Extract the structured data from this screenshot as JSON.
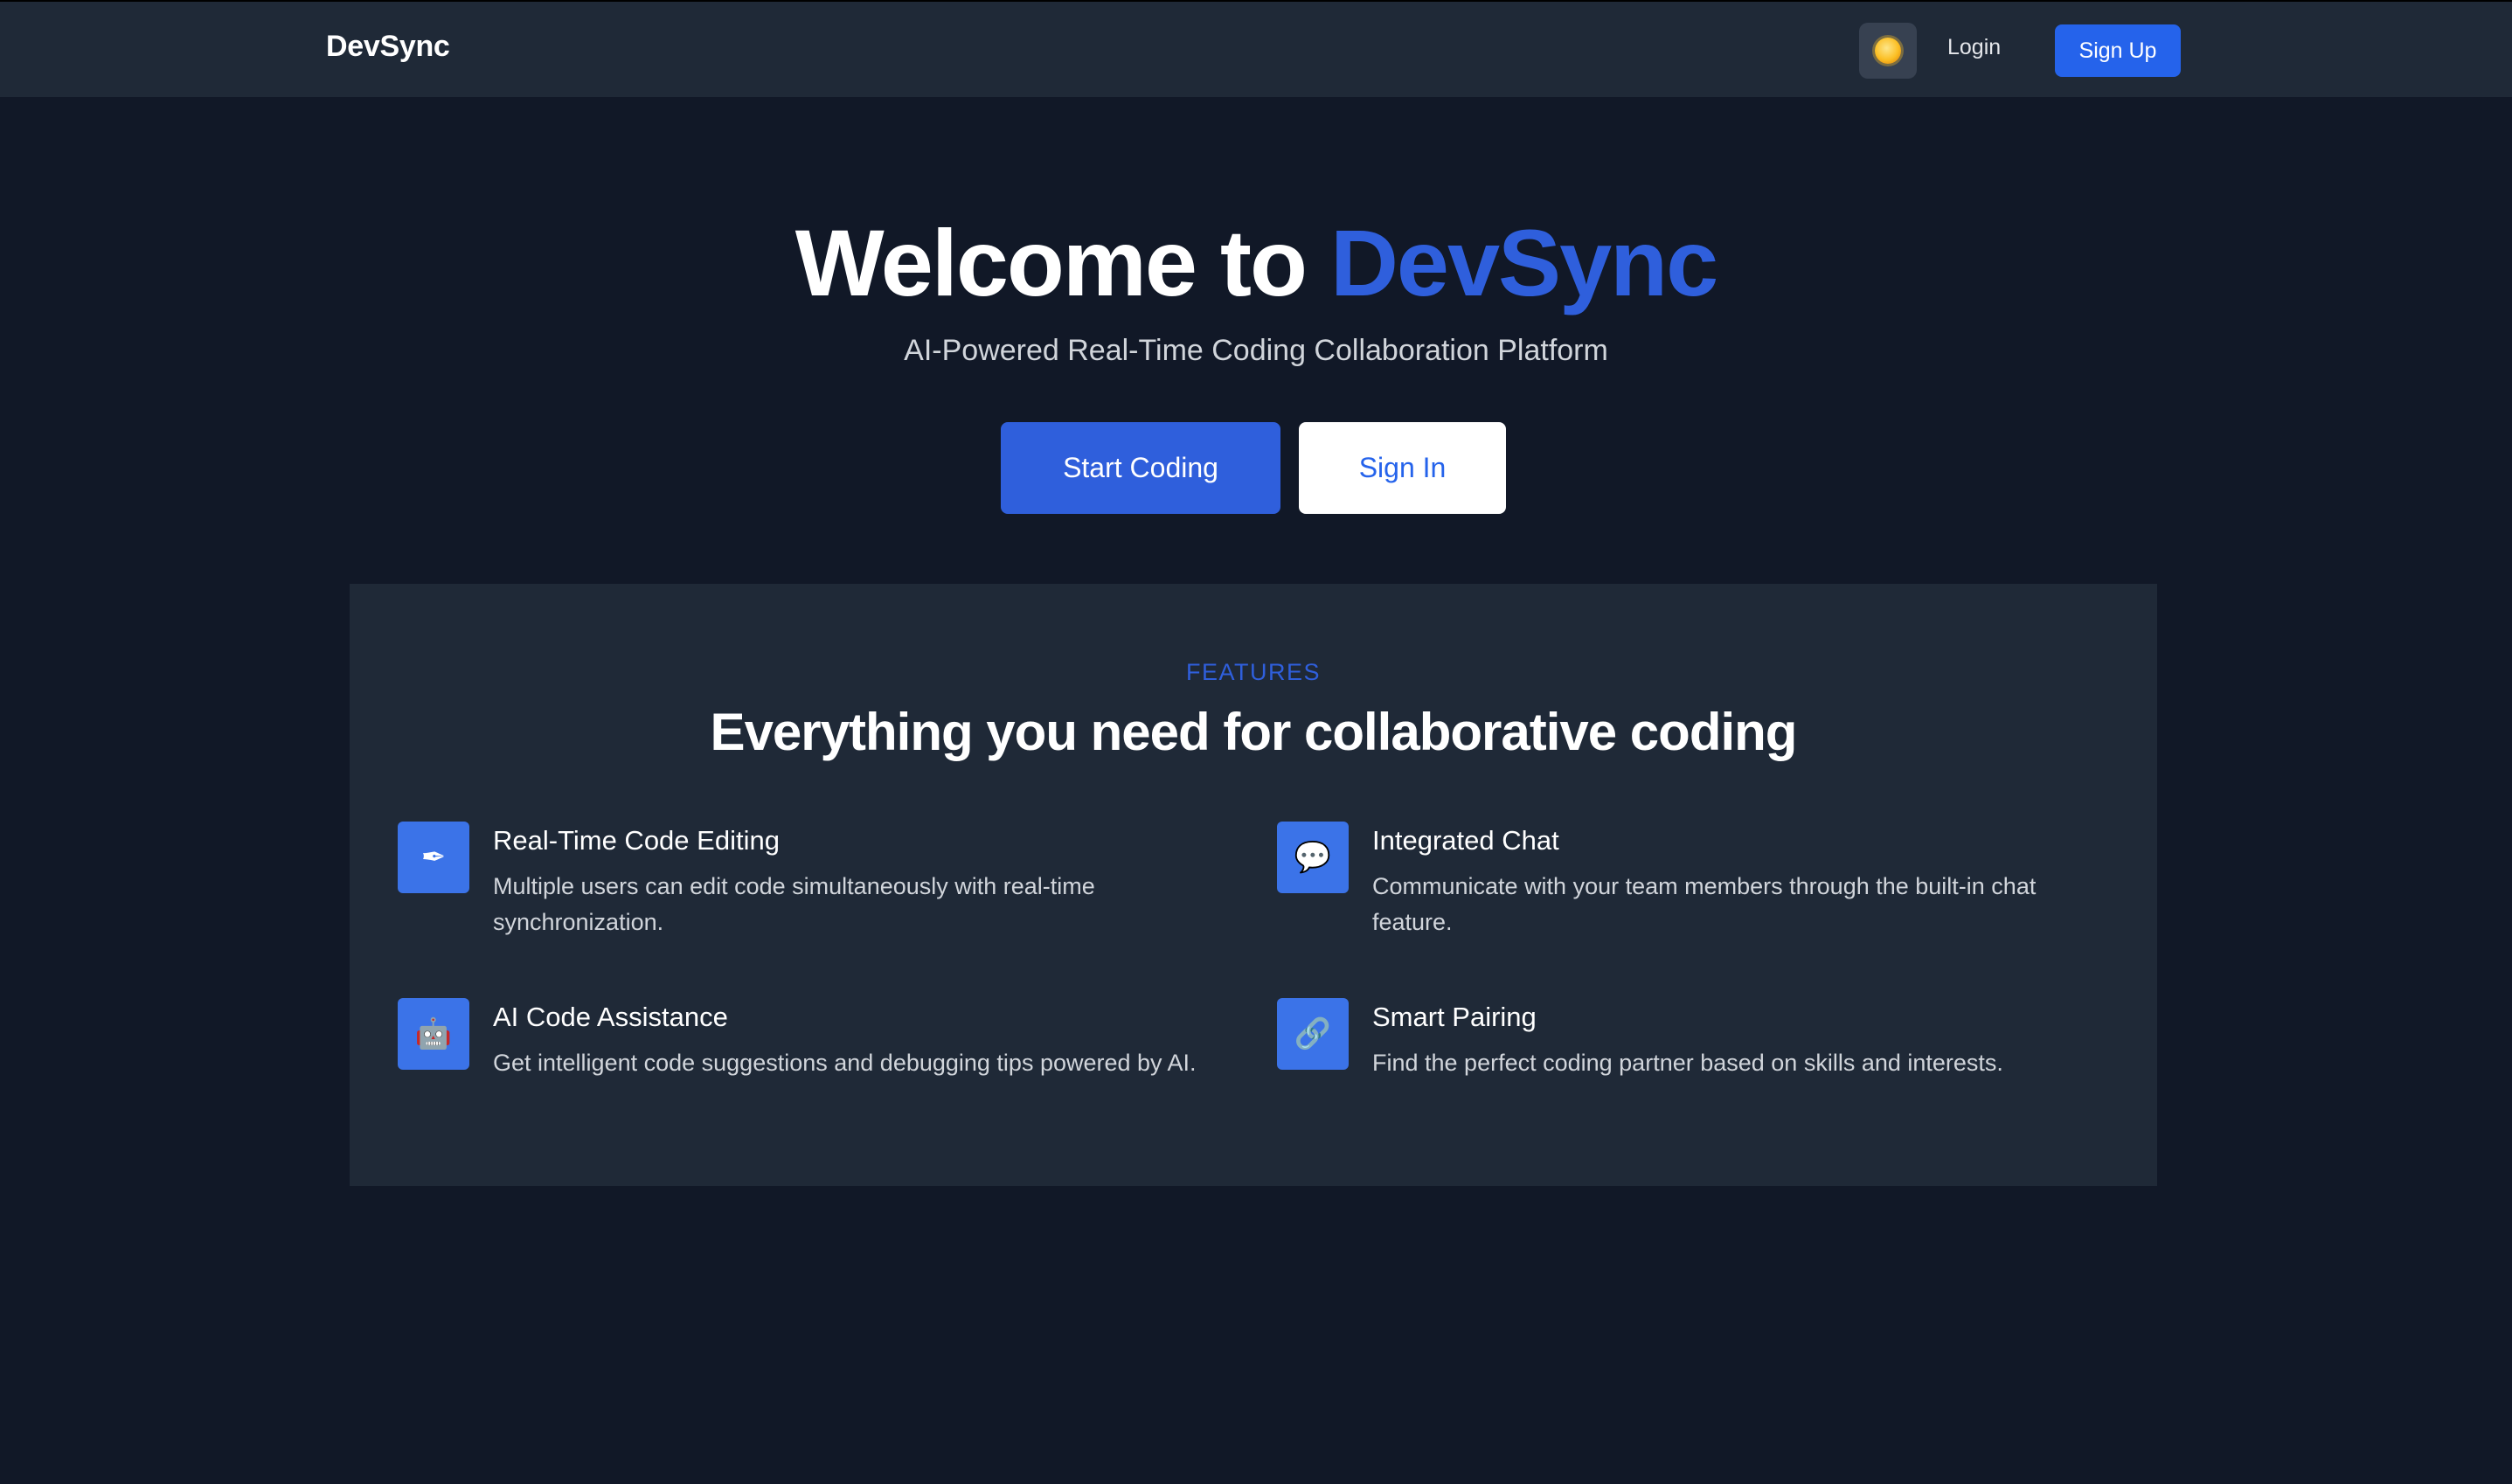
{
  "navbar": {
    "brand": "DevSync",
    "theme_toggle_icon": "sun-icon",
    "login_label": "Login",
    "signup_label": "Sign Up"
  },
  "hero": {
    "title_prefix": "Welcome to ",
    "title_accent": "DevSync",
    "subtitle": "AI-Powered Real-Time Coding Collaboration Platform",
    "primary_cta": "Start Coding",
    "secondary_cta": "Sign In"
  },
  "features": {
    "eyebrow": "FEATURES",
    "heading": "Everything you need for collaborative coding",
    "items": [
      {
        "icon": "pen-icon",
        "glyph": "✒",
        "title": "Real-Time Code Editing",
        "description": "Multiple users can edit code simultaneously with real-time synchronization."
      },
      {
        "icon": "chat-bubble-icon",
        "glyph": "💬",
        "title": "Integrated Chat",
        "description": "Communicate with your team members through the built-in chat feature."
      },
      {
        "icon": "robot-icon",
        "glyph": "🤖",
        "title": "AI Code Assistance",
        "description": "Get intelligent code suggestions and debugging tips powered by AI."
      },
      {
        "icon": "link-icon",
        "glyph": "🔗",
        "title": "Smart Pairing",
        "description": "Find the perfect coding partner based on skills and interests."
      }
    ]
  },
  "colors": {
    "background": "#111827",
    "panel": "#1f2937",
    "accent": "#2f5fdc",
    "icon_tile": "#3b73e8"
  }
}
